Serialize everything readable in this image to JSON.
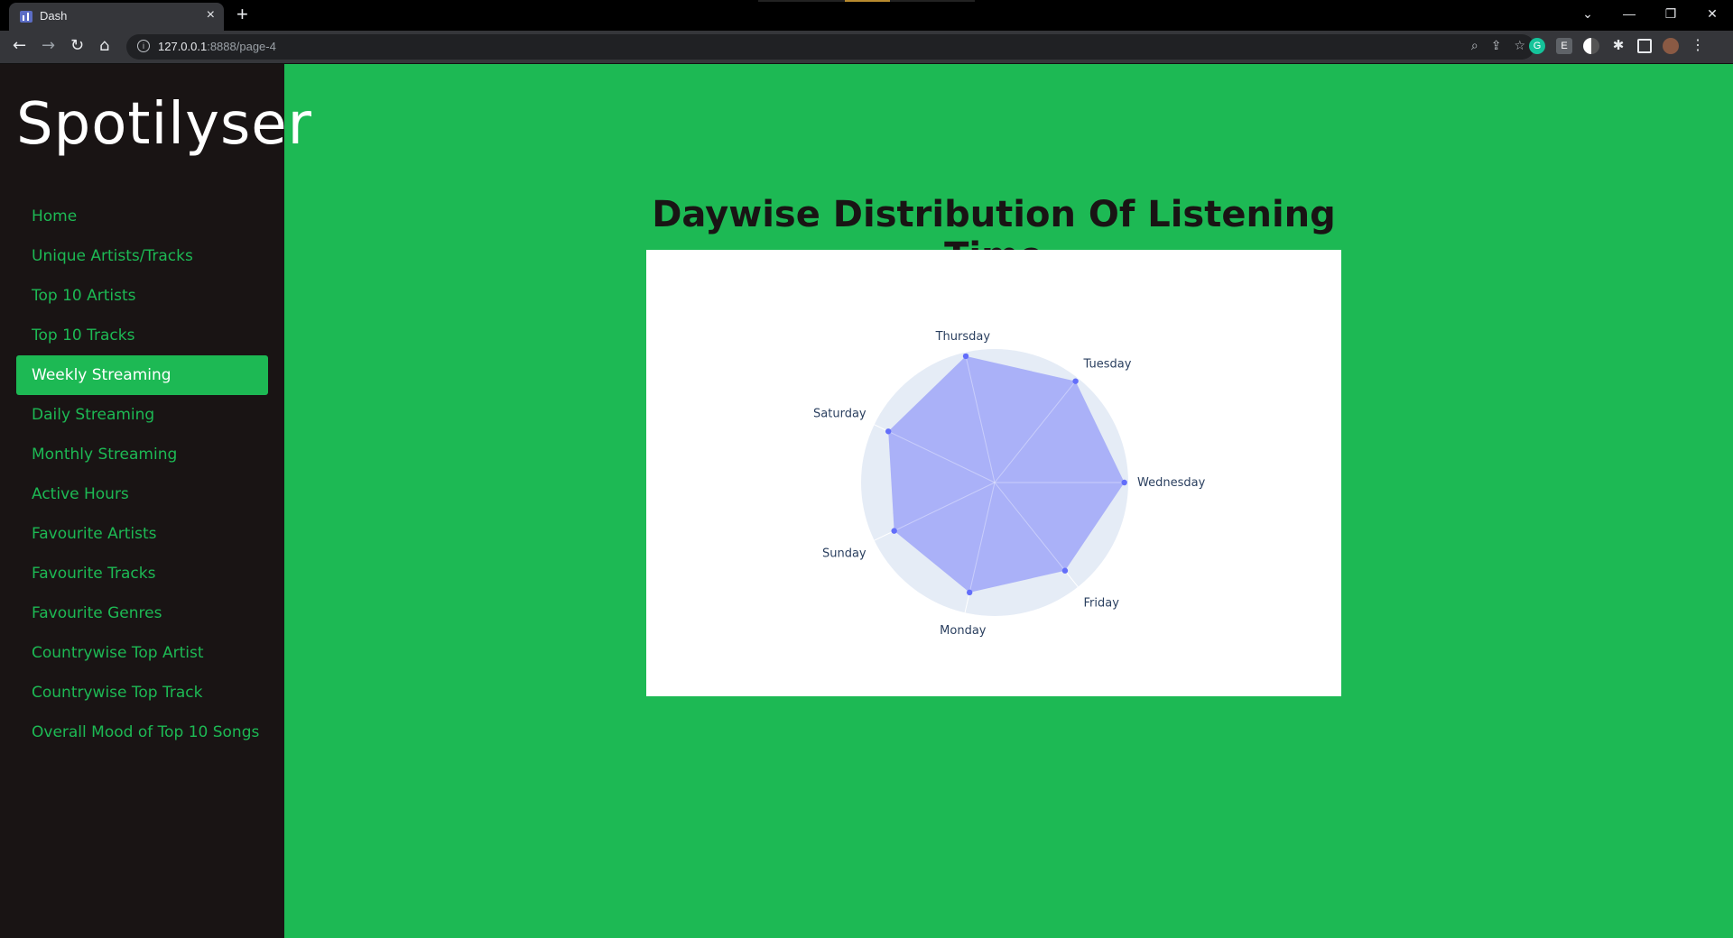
{
  "browser": {
    "tab_title": "Dash",
    "tab_close": "×",
    "new_tab": "+",
    "url_host": "127.0.0.1",
    "url_rest": ":8888/page-4",
    "window_controls": [
      "⌄",
      "—",
      "❐",
      "✕"
    ]
  },
  "sidebar": {
    "brand": "Spotilyser",
    "items": [
      {
        "label": "Home"
      },
      {
        "label": "Unique Artists/Tracks"
      },
      {
        "label": "Top 10 Artists"
      },
      {
        "label": "Top 10 Tracks"
      },
      {
        "label": "Weekly Streaming",
        "active": true
      },
      {
        "label": "Daily Streaming"
      },
      {
        "label": "Monthly Streaming"
      },
      {
        "label": "Active Hours"
      },
      {
        "label": "Favourite Artists"
      },
      {
        "label": "Favourite Tracks"
      },
      {
        "label": "Favourite Genres"
      },
      {
        "label": "Countrywise Top Artist"
      },
      {
        "label": "Countrywise Top Track"
      },
      {
        "label": "Overall Mood of Top 10 Songs"
      }
    ]
  },
  "main": {
    "title": "Daywise Distribution Of Listening Time"
  },
  "colors": {
    "page_bg": "#1db954",
    "sidebar_bg": "#191414",
    "radar_fill": "#a3abf8",
    "radar_marker": "#636efa",
    "polar_bg": "#e5ecf6"
  },
  "chart_data": {
    "type": "radar",
    "categories": [
      "Wednesday",
      "Tuesday",
      "Thursday",
      "Saturday",
      "Sunday",
      "Monday",
      "Friday"
    ],
    "values": [
      1.0,
      1.0,
      1.0,
      0.91,
      0.86,
      0.87,
      0.87
    ],
    "radial_range": [
      0,
      1.03
    ],
    "angular_direction": "counterclockwise",
    "grid": true
  }
}
